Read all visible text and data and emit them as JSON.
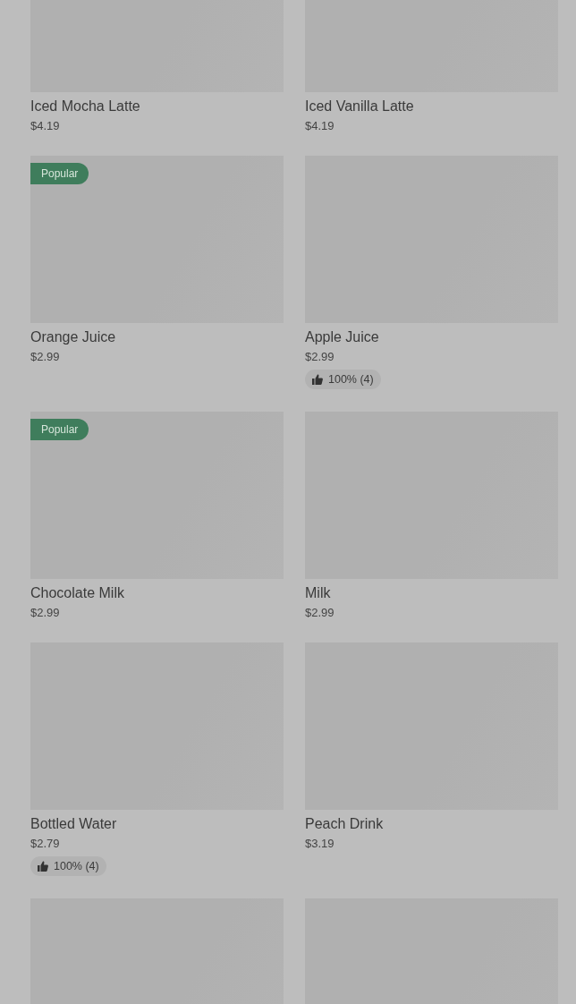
{
  "products": [
    {
      "kind": "product",
      "name": "Iced Mocha Latte",
      "price": "$4.19"
    },
    {
      "kind": "product",
      "name": "Iced Vanilla Latte",
      "price": "$4.19"
    },
    {
      "kind": "product",
      "name": "Orange Juice",
      "price": "$2.99",
      "badge": "Popular"
    },
    {
      "kind": "product",
      "name": "Apple Juice",
      "price": "$2.99",
      "rating": "100% (4)"
    },
    {
      "kind": "product",
      "name": "Chocolate Milk",
      "price": "$2.99",
      "badge": "Popular"
    },
    {
      "kind": "product",
      "name": "Milk",
      "price": "$2.99"
    },
    {
      "kind": "product",
      "name": "Bottled Water",
      "price": "$2.79",
      "rating": "100% (4)"
    },
    {
      "kind": "product",
      "name": "Peach Drink",
      "price": "$3.19"
    },
    {
      "kind": "picture"
    },
    {
      "kind": "picture"
    }
  ]
}
